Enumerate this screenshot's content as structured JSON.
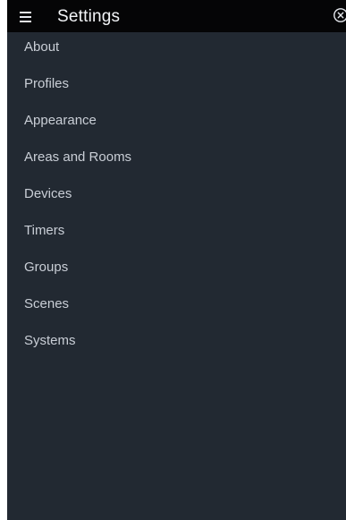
{
  "header": {
    "title": "Settings",
    "menu_icon": "hamburger-menu-icon",
    "close_icon": "close-circle-icon"
  },
  "menu": {
    "items": [
      {
        "label": "About"
      },
      {
        "label": "Profiles"
      },
      {
        "label": "Appearance"
      },
      {
        "label": "Areas and Rooms"
      },
      {
        "label": "Devices"
      },
      {
        "label": "Timers"
      },
      {
        "label": "Groups"
      },
      {
        "label": "Scenes"
      },
      {
        "label": "Systems"
      }
    ]
  },
  "colors": {
    "panel_background": "#222932",
    "header_background": "#050506",
    "item_text": "#c9ced6",
    "title_text": "#f2f4f7"
  }
}
